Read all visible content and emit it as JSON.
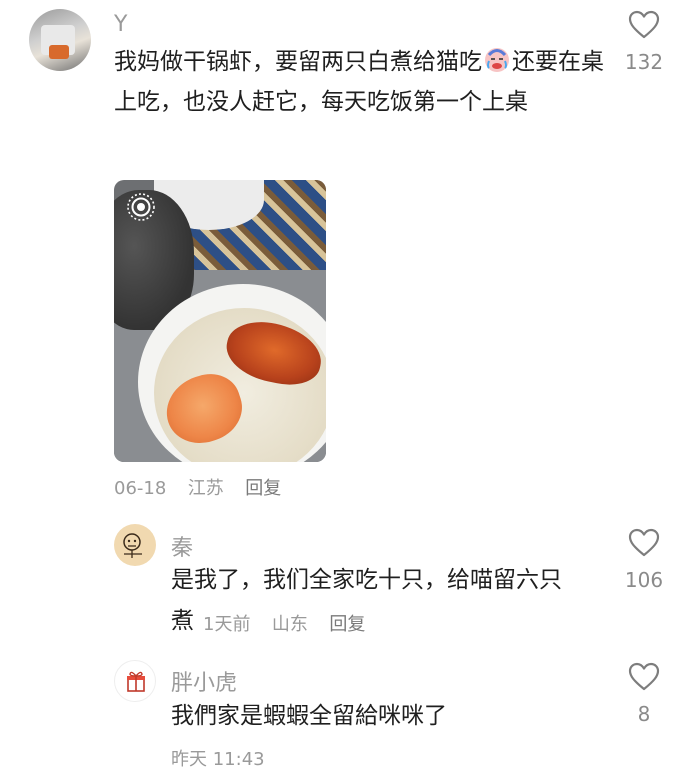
{
  "comments": [
    {
      "user": "Y",
      "text_before_emoji": "我妈做干锅虾，要留两只白煮给猫吃",
      "emoji": "crying-face-emoji",
      "text_after_emoji": "还要在桌上吃，也没人赶它，每天吃饭第一个上桌",
      "date": "06-18",
      "location": "江苏",
      "reply_label": "回复",
      "likes": "132"
    },
    {
      "user": "秦",
      "text": "是我了，我们全家吃十只，给喵留六只",
      "text_tail": "煮",
      "time": "1天前",
      "location": "山东",
      "reply_label": "回复",
      "likes": "106"
    },
    {
      "user": "胖小虎",
      "text": "我們家是蝦蝦全留給咪咪了",
      "time": "昨天 11:43",
      "likes": "8"
    }
  ],
  "icons": {
    "like": "heart-outline-icon",
    "live_photo": "live-photo-icon"
  },
  "colors": {
    "text": "#1f1f1f",
    "muted": "#9a9a9a",
    "icon": "#7d7d7d"
  }
}
